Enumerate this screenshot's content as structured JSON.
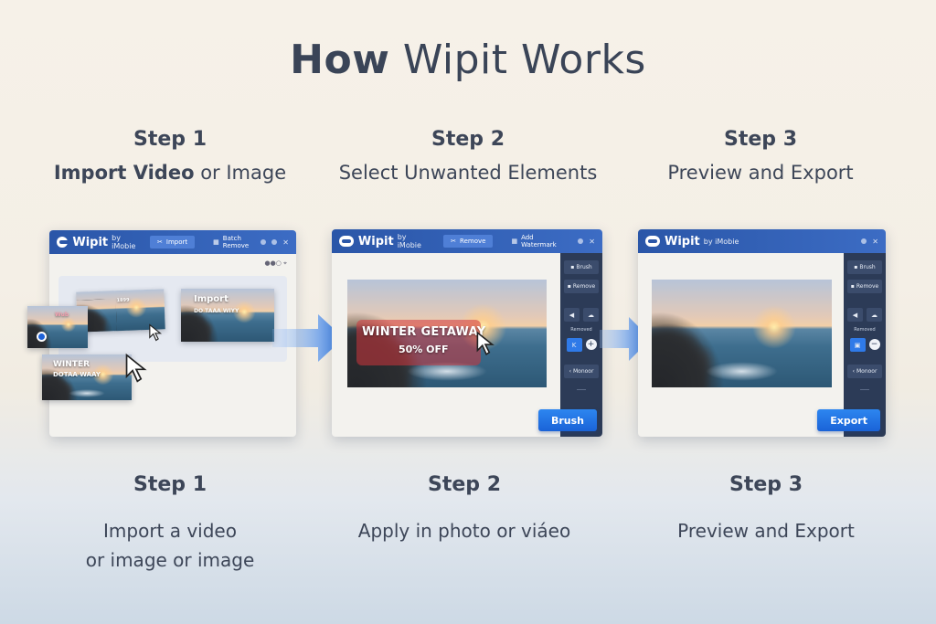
{
  "title": {
    "part1": "How",
    "part2": "Wipit Works"
  },
  "steps_top": [
    {
      "num": "Step 1",
      "sub_bold": "Import Video",
      "sub_rest": " or Image"
    },
    {
      "num": "Step 2",
      "sub": "Select Unwanted Elements"
    },
    {
      "num": "Step 3",
      "sub": "Preview and Export"
    }
  ],
  "steps_bottom": [
    {
      "num": "Step 1",
      "line1": "Import a video",
      "line2": "or image or image"
    },
    {
      "num": "Step 2",
      "line1": "Apply in photo or viáeo"
    },
    {
      "num": "Step 3",
      "line1": "Preview and Export"
    }
  ],
  "app": {
    "name": "Wipit",
    "by": "by iMobie"
  },
  "win1": {
    "tab_import": "Import",
    "tab_batch": "Batch Remove",
    "card_a_text": "WINTER",
    "card_a_sub": "GETAWAY",
    "card_b_text": "Import",
    "card_b_sub": "DO TAAA WIYY",
    "card_c_text": "WINTER",
    "card_c_sub": "DOTAA WAAY",
    "card_d_text": "Wub",
    "card_top_text": "1899"
  },
  "win2": {
    "tab_remove": "Remove",
    "tab_watermark": "Add Watermark",
    "tools": {
      "brush": "Brush",
      "remove": "Remove",
      "removed": "Removed",
      "undo": "Monoor"
    },
    "overlay_title": "WINTER GETAWAY",
    "overlay_sub": "50% OFF",
    "cta": "Brush"
  },
  "win3": {
    "tools": {
      "brush": "Brush",
      "remove": "Remove",
      "removed": "Removed",
      "undo": "Monoor"
    },
    "cta": "Export"
  },
  "colors": {
    "brand": "#2a56a8",
    "accent": "#2d86f0",
    "sidebar": "#2c3b57"
  }
}
